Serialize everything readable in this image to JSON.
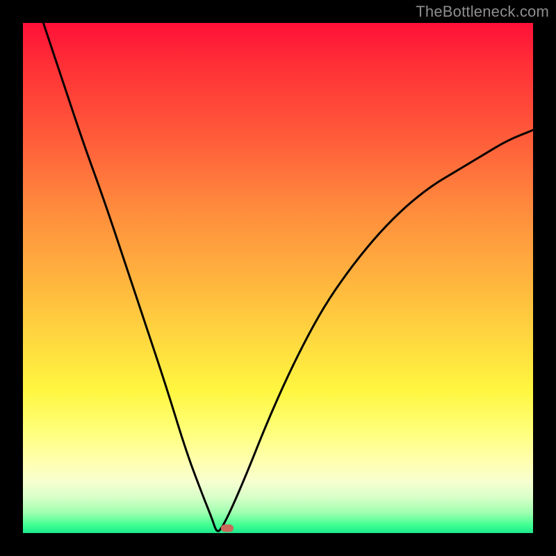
{
  "watermark": "TheBottleneck.com",
  "colors": {
    "frame": "#000000",
    "gradient_top": "#ff1038",
    "gradient_mid": "#ffd83f",
    "gradient_bottom": "#1de88e",
    "curve": "#000000",
    "marker": "#c96a5a",
    "watermark_text": "#8e8e8e"
  },
  "chart_data": {
    "type": "line",
    "title": "",
    "xlabel": "",
    "ylabel": "",
    "xlim": [
      0,
      100
    ],
    "ylim": [
      0,
      100
    ],
    "grid": false,
    "legend": false,
    "minimum_x": 38,
    "marker": {
      "x": 40,
      "y": 1
    },
    "series": [
      {
        "name": "curve",
        "x": [
          4,
          8,
          12,
          16,
          20,
          24,
          28,
          32,
          35,
          37,
          38,
          39,
          41,
          44,
          48,
          52,
          56,
          60,
          65,
          70,
          75,
          80,
          85,
          90,
          95,
          100
        ],
        "y": [
          100,
          88,
          76,
          65,
          53,
          41,
          29,
          16,
          8,
          3,
          0,
          1,
          5,
          12,
          22,
          31,
          39,
          46,
          53,
          59,
          64,
          68,
          71,
          74,
          77,
          79
        ]
      }
    ]
  }
}
